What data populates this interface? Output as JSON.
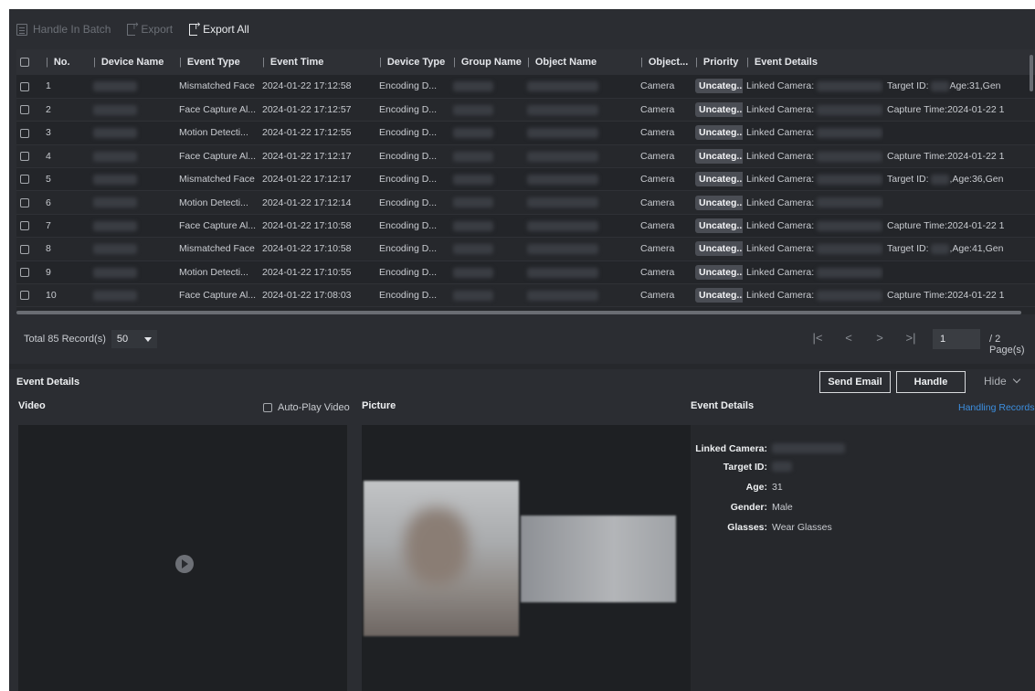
{
  "toolbar": {
    "handle_batch": "Handle In Batch",
    "export": "Export",
    "export_all": "Export All"
  },
  "table": {
    "headers": [
      "No.",
      "Device Name",
      "Event Type",
      "Event Time",
      "Device Type",
      "Group Name",
      "Object Name",
      "Object...",
      "Priority",
      "Event Details"
    ],
    "rows": [
      {
        "no": "1",
        "event_type": "Mismatched Face",
        "time": "2024-01-22 17:12:58",
        "device_type": "Encoding D...",
        "object": "Camera",
        "priority": "Uncateg...",
        "linked": "Linked Camera:",
        "extra": "Target ID:",
        "extra2": "Age:31,Gen"
      },
      {
        "no": "2",
        "event_type": "Face Capture Al...",
        "time": "2024-01-22 17:12:57",
        "device_type": "Encoding D...",
        "object": "Camera",
        "priority": "Uncateg...",
        "linked": "Linked Camera:",
        "extra": "Capture Time:2024-01-22 1",
        "extra2": ""
      },
      {
        "no": "3",
        "event_type": "Motion Detecti...",
        "time": "2024-01-22 17:12:55",
        "device_type": "Encoding D...",
        "object": "Camera",
        "priority": "Uncateg...",
        "linked": "Linked Camera:",
        "extra": "",
        "extra2": ""
      },
      {
        "no": "4",
        "event_type": "Face Capture Al...",
        "time": "2024-01-22 17:12:17",
        "device_type": "Encoding D...",
        "object": "Camera",
        "priority": "Uncateg...",
        "linked": "Linked Camera:",
        "extra": "Capture Time:2024-01-22 1",
        "extra2": ""
      },
      {
        "no": "5",
        "event_type": "Mismatched Face",
        "time": "2024-01-22 17:12:17",
        "device_type": "Encoding D...",
        "object": "Camera",
        "priority": "Uncateg...",
        "linked": "Linked Camera:",
        "extra": "Target ID:",
        "extra2": ",Age:36,Gen"
      },
      {
        "no": "6",
        "event_type": "Motion Detecti...",
        "time": "2024-01-22 17:12:14",
        "device_type": "Encoding D...",
        "object": "Camera",
        "priority": "Uncateg...",
        "linked": "Linked Camera:",
        "extra": "",
        "extra2": ""
      },
      {
        "no": "7",
        "event_type": "Face Capture Al...",
        "time": "2024-01-22 17:10:58",
        "device_type": "Encoding D...",
        "object": "Camera",
        "priority": "Uncateg...",
        "linked": "Linked Camera:",
        "extra": "Capture Time:2024-01-22 1",
        "extra2": ""
      },
      {
        "no": "8",
        "event_type": "Mismatched Face",
        "time": "2024-01-22 17:10:58",
        "device_type": "Encoding D...",
        "object": "Camera",
        "priority": "Uncateg...",
        "linked": "Linked Camera:",
        "extra": "Target ID:",
        "extra2": ",Age:41,Gen"
      },
      {
        "no": "9",
        "event_type": "Motion Detecti...",
        "time": "2024-01-22 17:10:55",
        "device_type": "Encoding D...",
        "object": "Camera",
        "priority": "Uncateg...",
        "linked": "Linked Camera:",
        "extra": "",
        "extra2": ""
      },
      {
        "no": "10",
        "event_type": "Face Capture Al...",
        "time": "2024-01-22 17:08:03",
        "device_type": "Encoding D...",
        "object": "Camera",
        "priority": "Uncateg...",
        "linked": "Linked Camera:",
        "extra": "Capture Time:2024-01-22 1",
        "extra2": ""
      }
    ]
  },
  "pagination": {
    "total": "Total 85 Record(s)",
    "page_size": "50",
    "first": "|<",
    "prev": "<",
    "next": ">",
    "last": ">|",
    "current_page": "1",
    "total_pages": "/ 2 Page(s)"
  },
  "event_details_bar": {
    "title": "Event Details",
    "send_email": "Send Email",
    "handle": "Handle",
    "hide": "Hide"
  },
  "panels": {
    "video_title": "Video",
    "auto_play": "Auto-Play Video",
    "picture_title": "Picture",
    "details_title": "Event Details",
    "handling_records": "Handling Records"
  },
  "details": {
    "linked_camera_label": "Linked Camera:",
    "target_id_label": "Target ID:",
    "age_label": "Age:",
    "age_value": "31",
    "gender_label": "Gender:",
    "gender_value": "Male",
    "glasses_label": "Glasses:",
    "glasses_value": "Wear Glasses"
  },
  "colors": {
    "background": "#2b2d32",
    "accent_link": "#3c8fe0",
    "badge": "#4a4d54"
  }
}
